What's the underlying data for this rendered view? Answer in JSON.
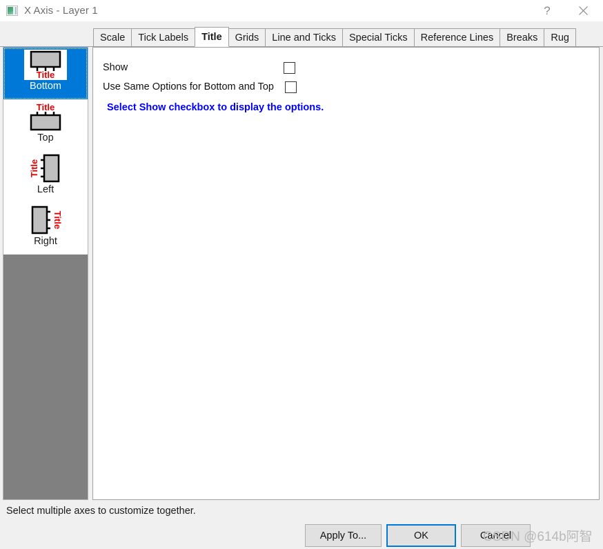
{
  "window": {
    "title": "X Axis - Layer 1",
    "icon": "axis-dialog-icon",
    "help_button": "?",
    "close_button": "close-icon"
  },
  "tabs": [
    {
      "label": "Scale",
      "active": false
    },
    {
      "label": "Tick Labels",
      "active": false
    },
    {
      "label": "Title",
      "active": true
    },
    {
      "label": "Grids",
      "active": false
    },
    {
      "label": "Line and Ticks",
      "active": false
    },
    {
      "label": "Special Ticks",
      "active": false
    },
    {
      "label": "Reference Lines",
      "active": false
    },
    {
      "label": "Breaks",
      "active": false
    },
    {
      "label": "Rug",
      "active": false
    }
  ],
  "sidebar": {
    "items": [
      {
        "label": "Bottom",
        "icon": "axis-bottom-title-icon",
        "selected": true
      },
      {
        "label": "Top",
        "icon": "axis-top-title-icon",
        "selected": false
      },
      {
        "label": "Left",
        "icon": "axis-left-title-icon",
        "selected": false
      },
      {
        "label": "Right",
        "icon": "axis-right-title-icon",
        "selected": false
      }
    ],
    "glyph_title_text": "Title"
  },
  "main": {
    "options": [
      {
        "label": "Show",
        "checked": false
      },
      {
        "label": "Use Same Options for Bottom and Top",
        "checked": false
      }
    ],
    "hint": "Select Show checkbox to display the options.",
    "hint_color": "#0000ff"
  },
  "statusbar": {
    "text": "Select multiple axes to customize together."
  },
  "buttons": {
    "apply_to": "Apply To...",
    "ok": "OK",
    "cancel": "Cancel"
  },
  "watermark": {
    "text": "CSDN @6⁠14b阿智"
  },
  "colors": {
    "accent": "#0078d7",
    "selection": "#0078d7",
    "hint": "#0000ff",
    "sidebar_empty": "#808080",
    "title_glyph_red": "#e60000"
  }
}
